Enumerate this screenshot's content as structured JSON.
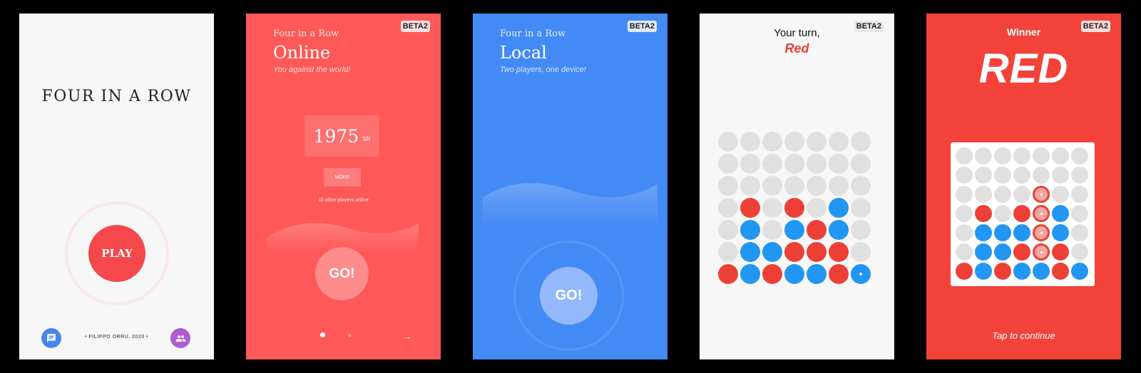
{
  "beta_badge": "BETA2",
  "colors": {
    "red": "#ec4037",
    "blue": "#2196f3",
    "empty": "#e0e0e0",
    "light_red": "#f3a6a2"
  },
  "screen_home": {
    "title": "FOUR IN A ROW",
    "play_label": "PLAY",
    "footer": "• FILIPPO ORRU, 2020 •",
    "chat_icon": "chat-icon",
    "group_icon": "group-icon"
  },
  "screen_online": {
    "kicker": "Four in a Row",
    "title": "Online",
    "subtitle": "You against the world!",
    "rating_value": "1975",
    "rating_unit": "SR",
    "more_label": "MORE",
    "players_online": "10 other players online",
    "go_label": "GO!",
    "page_indicator": {
      "current": 1,
      "total": 2
    },
    "next_icon": "arrow-right-icon"
  },
  "screen_local": {
    "kicker": "Four in a Row",
    "title": "Local",
    "subtitle": "Two players, one device!",
    "go_label": "GO!"
  },
  "screen_game": {
    "turn_label": "Your turn,",
    "turn_player": "Red",
    "board": [
      [
        "E",
        "E",
        "E",
        "E",
        "E",
        "E",
        "E"
      ],
      [
        "E",
        "E",
        "E",
        "E",
        "E",
        "E",
        "E"
      ],
      [
        "E",
        "E",
        "E",
        "E",
        "E",
        "E",
        "E"
      ],
      [
        "E",
        "R",
        "E",
        "R",
        "E",
        "B",
        "E"
      ],
      [
        "E",
        "B",
        "E",
        "B",
        "R",
        "B",
        "E"
      ],
      [
        "E",
        "B",
        "B",
        "R",
        "R",
        "R",
        "E"
      ],
      [
        "R",
        "B",
        "R",
        "B",
        "B",
        "R",
        "B*"
      ]
    ]
  },
  "screen_winner": {
    "label": "Winner",
    "name": "RED",
    "tap_label": "Tap to continue",
    "board": [
      [
        "E",
        "E",
        "E",
        "E",
        "E",
        "E",
        "E"
      ],
      [
        "E",
        "E",
        "E",
        "E",
        "E",
        "E",
        "E"
      ],
      [
        "E",
        "E",
        "E",
        "E",
        "W",
        "E",
        "E"
      ],
      [
        "E",
        "R",
        "E",
        "R",
        "W",
        "B",
        "E"
      ],
      [
        "E",
        "B",
        "B",
        "B",
        "W",
        "B",
        "E"
      ],
      [
        "E",
        "B",
        "B",
        "R",
        "W",
        "R",
        "E"
      ],
      [
        "R",
        "B",
        "R",
        "B",
        "B",
        "R",
        "B"
      ]
    ]
  }
}
